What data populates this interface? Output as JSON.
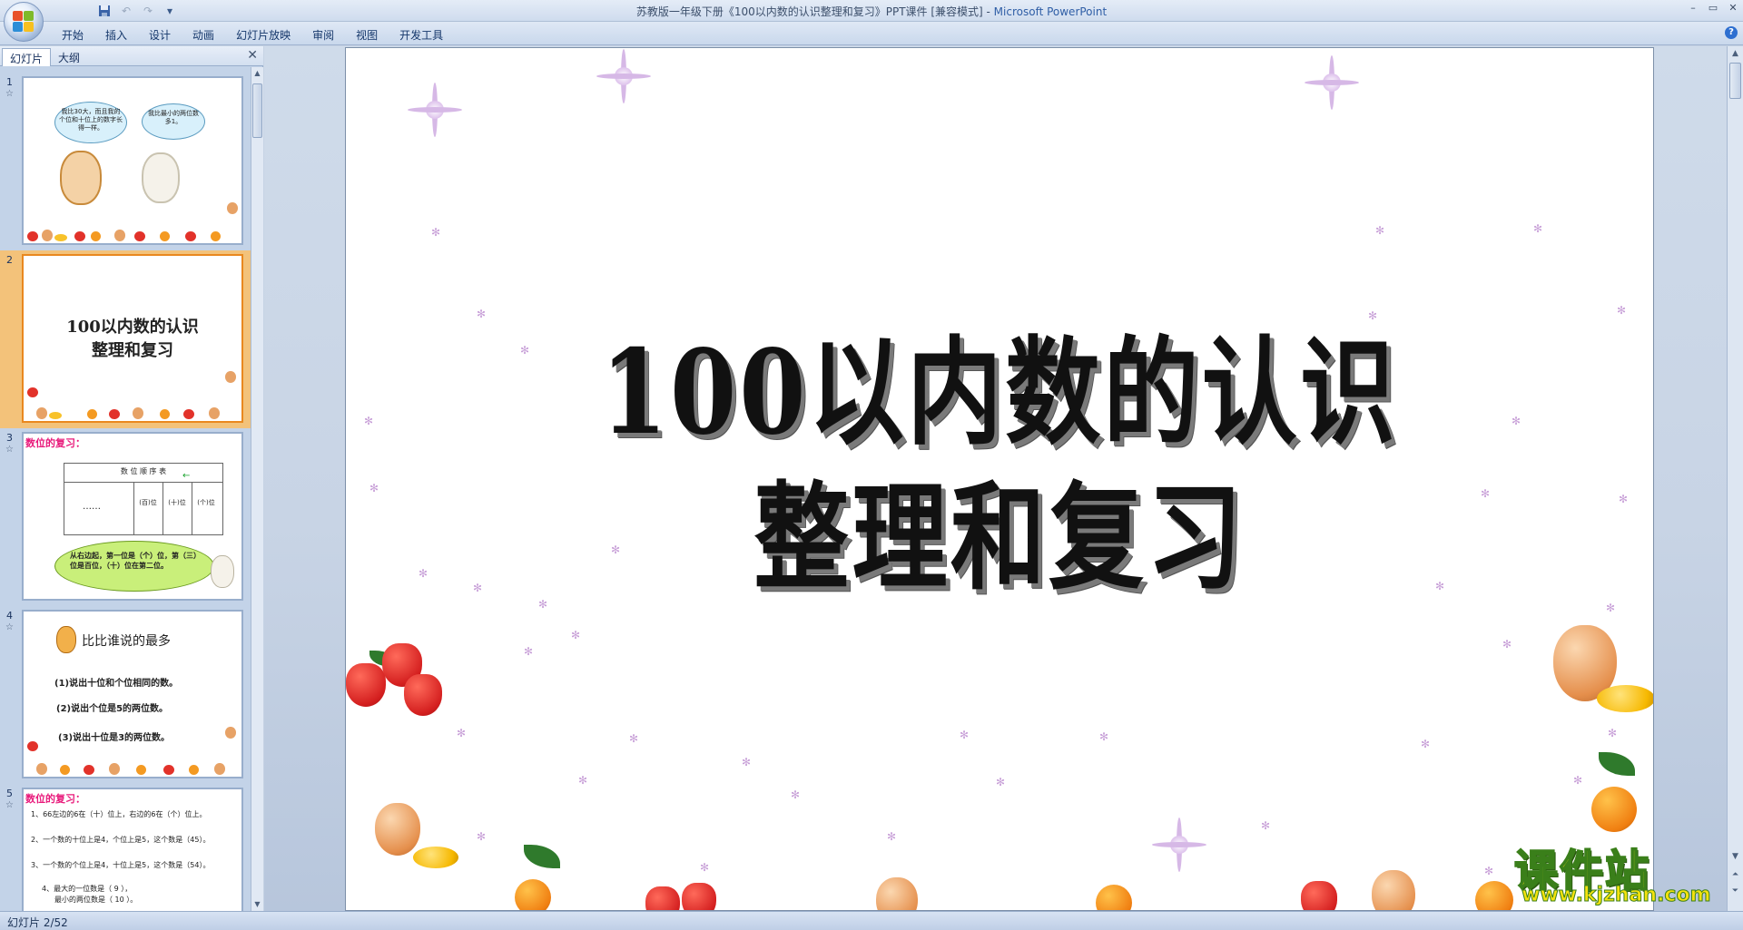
{
  "window": {
    "title_doc": "苏教版一年级下册《100以内数的认识整理和复习》PPT课件 [兼容模式] - ",
    "title_app": "Microsoft PowerPoint"
  },
  "quick_access": {
    "save_icon": "save-icon",
    "undo_icon": "undo-icon",
    "redo_icon": "redo-icon",
    "customize_icon": "dropdown-icon"
  },
  "window_controls": {
    "minimize": "–",
    "restore": "▭",
    "close": "✕"
  },
  "ribbon": {
    "tabs": [
      "开始",
      "插入",
      "设计",
      "动画",
      "幻灯片放映",
      "审阅",
      "视图",
      "开发工具"
    ],
    "help": "?"
  },
  "left_pane": {
    "tab_slides": "幻灯片",
    "tab_outline": "大纲",
    "close": "✕",
    "thumbnails": [
      {
        "number": "1",
        "bubble_left": "我比30大，而且我的个位和十位上的数字长得一样。",
        "bubble_right": "我比最小的两位数多1。"
      },
      {
        "number": "2",
        "line1": "100以内数的认识",
        "line2": "整理和复习"
      },
      {
        "number": "3",
        "heading": "数位的复习：",
        "table_header": "数 位 顺 序 表",
        "dots": "……",
        "col_hundreds": "(百)位",
        "col_tens": "(十)位",
        "col_ones": "(个)位",
        "bubble": "从右边起，第一位是（个）位，第（三）位是百位，（十）位在第二位。"
      },
      {
        "number": "4",
        "heading": "比比谁说的最多",
        "q1": "(1)说出十位和个位相同的数。",
        "q2": "(2)说出个位是5的两位数。",
        "q3": "(3)说出十位是3的两位数。"
      },
      {
        "number": "5",
        "heading": "数位的复习：",
        "l1": "1、66左边的6在（十）位上，右边的6在（个）位上。",
        "l2": "2、一个数的十位上是4，个位上是5，这个数是（45）。",
        "l3": "3、一个数的个位上是4，十位上是5，这个数是（54）。",
        "l4": "4、最大的一位数是（ 9 ），",
        "l5": "最小的两位数是（ 10 ）。"
      }
    ]
  },
  "slide": {
    "title_line1": "100以内数的认识",
    "title_line2": "整理和复习"
  },
  "status": {
    "text": "幻灯片 2/52"
  },
  "watermark": {
    "main": "课件站",
    "url": "www.kjzhan.com"
  }
}
